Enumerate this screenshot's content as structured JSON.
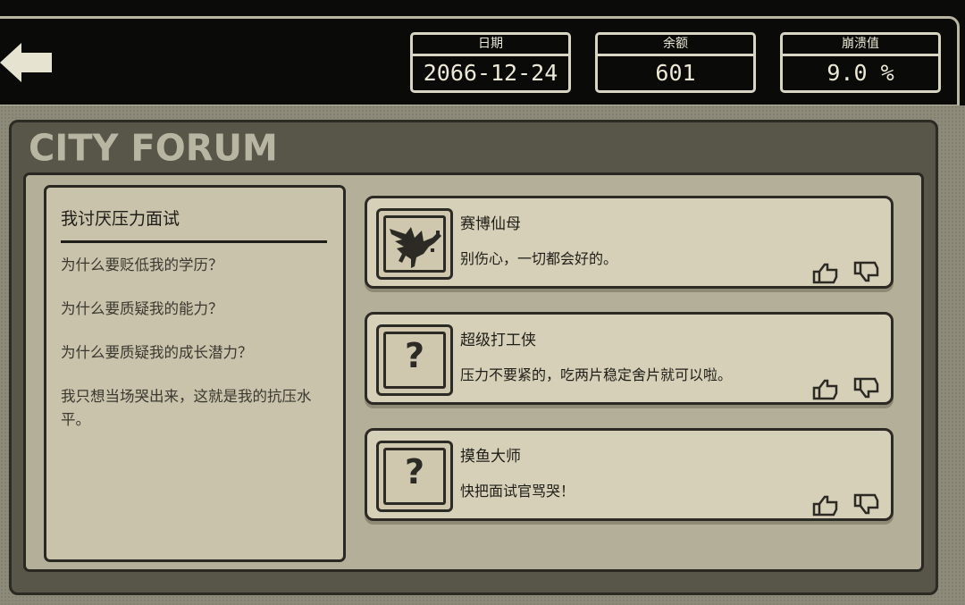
{
  "header": {
    "back_icon": "back-arrow-icon",
    "stats": [
      {
        "label": "日期",
        "value": "2066-12-24"
      },
      {
        "label": "余额",
        "value": "601"
      },
      {
        "label": "崩溃值",
        "value": "9.0 %"
      }
    ]
  },
  "forum": {
    "title": "CITY FORUM",
    "post": {
      "title": "我讨厌压力面试",
      "lines": [
        "为什么要贬低我的学历？",
        "为什么要质疑我的能力？",
        "为什么要质疑我的成长潜力？",
        "我只想当场哭出来，这就是我的抗压水平。"
      ]
    },
    "comments": [
      {
        "user": "赛博仙母",
        "text": "别伤心，一切都会好的。",
        "avatar": "bird-icon"
      },
      {
        "user": "超级打工侠",
        "text": "压力不要紧的，吃两片稳定舍片就可以啦。",
        "avatar": "question-mark-icon"
      },
      {
        "user": "摸鱼大师",
        "text": "快把面试官骂哭！",
        "avatar": "question-mark-icon"
      }
    ]
  },
  "colors": {
    "background": "#0b0b09",
    "panel": "#585549",
    "content": "#b4af98",
    "card": "#d6d0b8",
    "ink": "#2a2822"
  }
}
